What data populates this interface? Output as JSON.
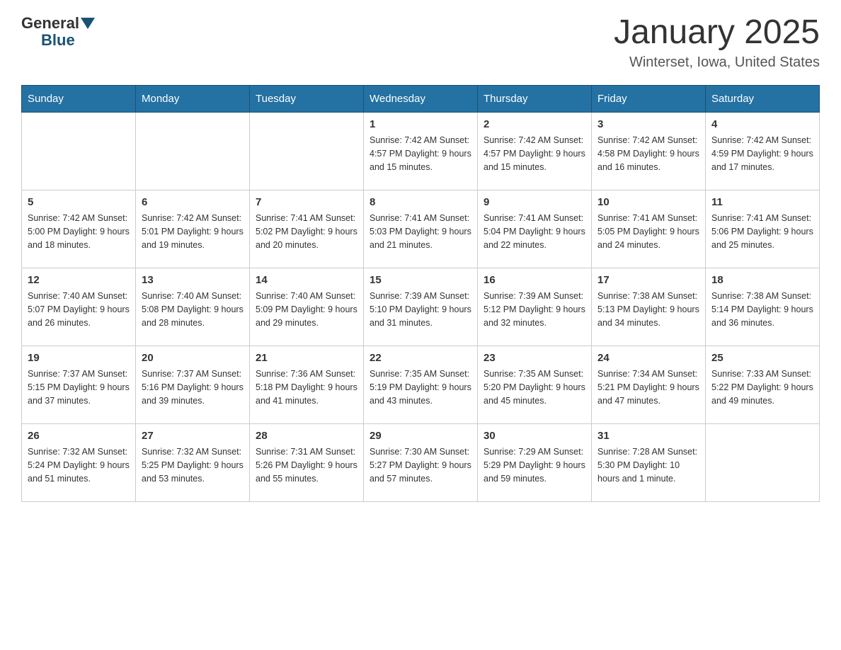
{
  "logo": {
    "general": "General",
    "blue": "Blue"
  },
  "title": "January 2025",
  "subtitle": "Winterset, Iowa, United States",
  "days_of_week": [
    "Sunday",
    "Monday",
    "Tuesday",
    "Wednesday",
    "Thursday",
    "Friday",
    "Saturday"
  ],
  "weeks": [
    [
      {
        "day": "",
        "info": ""
      },
      {
        "day": "",
        "info": ""
      },
      {
        "day": "",
        "info": ""
      },
      {
        "day": "1",
        "info": "Sunrise: 7:42 AM\nSunset: 4:57 PM\nDaylight: 9 hours\nand 15 minutes."
      },
      {
        "day": "2",
        "info": "Sunrise: 7:42 AM\nSunset: 4:57 PM\nDaylight: 9 hours\nand 15 minutes."
      },
      {
        "day": "3",
        "info": "Sunrise: 7:42 AM\nSunset: 4:58 PM\nDaylight: 9 hours\nand 16 minutes."
      },
      {
        "day": "4",
        "info": "Sunrise: 7:42 AM\nSunset: 4:59 PM\nDaylight: 9 hours\nand 17 minutes."
      }
    ],
    [
      {
        "day": "5",
        "info": "Sunrise: 7:42 AM\nSunset: 5:00 PM\nDaylight: 9 hours\nand 18 minutes."
      },
      {
        "day": "6",
        "info": "Sunrise: 7:42 AM\nSunset: 5:01 PM\nDaylight: 9 hours\nand 19 minutes."
      },
      {
        "day": "7",
        "info": "Sunrise: 7:41 AM\nSunset: 5:02 PM\nDaylight: 9 hours\nand 20 minutes."
      },
      {
        "day": "8",
        "info": "Sunrise: 7:41 AM\nSunset: 5:03 PM\nDaylight: 9 hours\nand 21 minutes."
      },
      {
        "day": "9",
        "info": "Sunrise: 7:41 AM\nSunset: 5:04 PM\nDaylight: 9 hours\nand 22 minutes."
      },
      {
        "day": "10",
        "info": "Sunrise: 7:41 AM\nSunset: 5:05 PM\nDaylight: 9 hours\nand 24 minutes."
      },
      {
        "day": "11",
        "info": "Sunrise: 7:41 AM\nSunset: 5:06 PM\nDaylight: 9 hours\nand 25 minutes."
      }
    ],
    [
      {
        "day": "12",
        "info": "Sunrise: 7:40 AM\nSunset: 5:07 PM\nDaylight: 9 hours\nand 26 minutes."
      },
      {
        "day": "13",
        "info": "Sunrise: 7:40 AM\nSunset: 5:08 PM\nDaylight: 9 hours\nand 28 minutes."
      },
      {
        "day": "14",
        "info": "Sunrise: 7:40 AM\nSunset: 5:09 PM\nDaylight: 9 hours\nand 29 minutes."
      },
      {
        "day": "15",
        "info": "Sunrise: 7:39 AM\nSunset: 5:10 PM\nDaylight: 9 hours\nand 31 minutes."
      },
      {
        "day": "16",
        "info": "Sunrise: 7:39 AM\nSunset: 5:12 PM\nDaylight: 9 hours\nand 32 minutes."
      },
      {
        "day": "17",
        "info": "Sunrise: 7:38 AM\nSunset: 5:13 PM\nDaylight: 9 hours\nand 34 minutes."
      },
      {
        "day": "18",
        "info": "Sunrise: 7:38 AM\nSunset: 5:14 PM\nDaylight: 9 hours\nand 36 minutes."
      }
    ],
    [
      {
        "day": "19",
        "info": "Sunrise: 7:37 AM\nSunset: 5:15 PM\nDaylight: 9 hours\nand 37 minutes."
      },
      {
        "day": "20",
        "info": "Sunrise: 7:37 AM\nSunset: 5:16 PM\nDaylight: 9 hours\nand 39 minutes."
      },
      {
        "day": "21",
        "info": "Sunrise: 7:36 AM\nSunset: 5:18 PM\nDaylight: 9 hours\nand 41 minutes."
      },
      {
        "day": "22",
        "info": "Sunrise: 7:35 AM\nSunset: 5:19 PM\nDaylight: 9 hours\nand 43 minutes."
      },
      {
        "day": "23",
        "info": "Sunrise: 7:35 AM\nSunset: 5:20 PM\nDaylight: 9 hours\nand 45 minutes."
      },
      {
        "day": "24",
        "info": "Sunrise: 7:34 AM\nSunset: 5:21 PM\nDaylight: 9 hours\nand 47 minutes."
      },
      {
        "day": "25",
        "info": "Sunrise: 7:33 AM\nSunset: 5:22 PM\nDaylight: 9 hours\nand 49 minutes."
      }
    ],
    [
      {
        "day": "26",
        "info": "Sunrise: 7:32 AM\nSunset: 5:24 PM\nDaylight: 9 hours\nand 51 minutes."
      },
      {
        "day": "27",
        "info": "Sunrise: 7:32 AM\nSunset: 5:25 PM\nDaylight: 9 hours\nand 53 minutes."
      },
      {
        "day": "28",
        "info": "Sunrise: 7:31 AM\nSunset: 5:26 PM\nDaylight: 9 hours\nand 55 minutes."
      },
      {
        "day": "29",
        "info": "Sunrise: 7:30 AM\nSunset: 5:27 PM\nDaylight: 9 hours\nand 57 minutes."
      },
      {
        "day": "30",
        "info": "Sunrise: 7:29 AM\nSunset: 5:29 PM\nDaylight: 9 hours\nand 59 minutes."
      },
      {
        "day": "31",
        "info": "Sunrise: 7:28 AM\nSunset: 5:30 PM\nDaylight: 10 hours\nand 1 minute."
      },
      {
        "day": "",
        "info": ""
      }
    ]
  ]
}
